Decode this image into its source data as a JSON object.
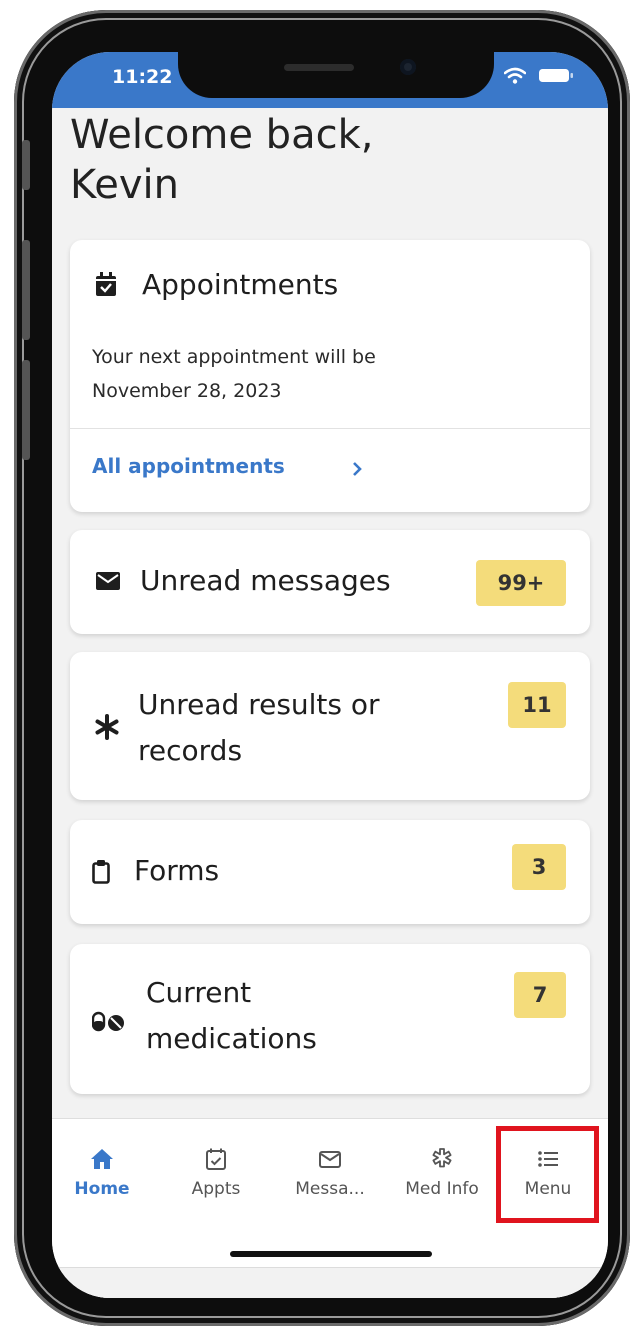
{
  "status_bar": {
    "time": "11:22"
  },
  "welcome": {
    "line1": "Welcome back,",
    "line2": "Kevin"
  },
  "appointments": {
    "title": "Appointments",
    "description_line1": "Your next appointment will be",
    "description_line2": "November 28, 2023",
    "link_label": "All appointments"
  },
  "unread_messages": {
    "title": "Unread messages",
    "badge": "99+"
  },
  "unread_results": {
    "title_line1": "Unread results or",
    "title_line2": "records",
    "badge": "11"
  },
  "forms": {
    "title": "Forms",
    "badge": "3"
  },
  "current_medications": {
    "title_line1": "Current",
    "title_line2": "medications",
    "badge": "7"
  },
  "tabbar": {
    "items": [
      {
        "label": "Home",
        "icon": "home-icon",
        "active": true
      },
      {
        "label": "Appts",
        "icon": "calendar-check-icon",
        "active": false
      },
      {
        "label": "Messa...",
        "icon": "envelope-icon",
        "active": false
      },
      {
        "label": "Med Info",
        "icon": "medical-icon",
        "active": false
      },
      {
        "label": "Menu",
        "icon": "list-icon",
        "active": false
      }
    ]
  },
  "colors": {
    "accent": "#3a78c9",
    "badge": "#f4dc7b",
    "highlight": "#e0141e",
    "background": "#f2f2f2"
  }
}
